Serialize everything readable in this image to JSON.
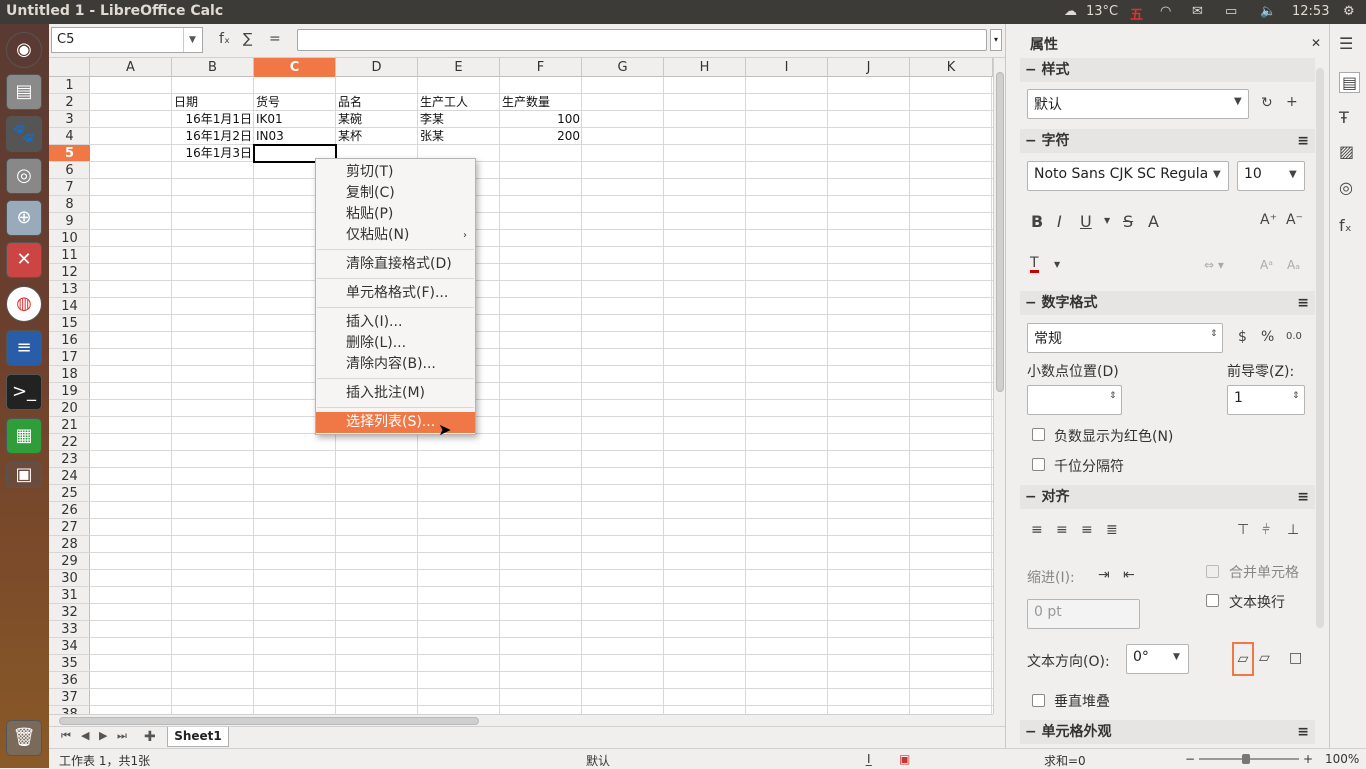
{
  "window": {
    "title": "Untitled 1 - LibreOffice Calc"
  },
  "indicators": {
    "temperature": "13°C",
    "time": "12:53"
  },
  "toolbar": {
    "name_box": "C5",
    "fx": "fₓ",
    "sum": "∑",
    "equals": "="
  },
  "columns": [
    "A",
    "B",
    "C",
    "D",
    "E",
    "F",
    "G",
    "H",
    "I",
    "J",
    "K"
  ],
  "rows": [
    "1",
    "2",
    "3",
    "4",
    "5",
    "6",
    "7",
    "8",
    "9",
    "10",
    "11",
    "12",
    "13",
    "14",
    "15",
    "16",
    "17",
    "18",
    "19",
    "20",
    "21",
    "22",
    "23",
    "24",
    "25",
    "26",
    "27",
    "28",
    "29",
    "30",
    "31",
    "32",
    "33",
    "34",
    "35",
    "36",
    "37",
    "38"
  ],
  "cells": {
    "B2": "日期",
    "C2": "货号",
    "D2": "品名",
    "E2": "生产工人",
    "F2": "生产数量",
    "B3": "16年1月1日",
    "C3": "IK01",
    "D3": "某碗",
    "E3": "李某",
    "F3": "100",
    "B4": "16年1月2日",
    "C4": "IN03",
    "D4": "某杯",
    "E4": "张某",
    "F4": "200",
    "B5": "16年1月3日"
  },
  "context_menu": {
    "cut": "剪切(T)",
    "copy": "复制(C)",
    "paste": "粘贴(P)",
    "paste_special": "仅粘贴(N)",
    "clear_direct": "清除直接格式(D)",
    "format_cells": "单元格格式(F)...",
    "insert": "插入(I)...",
    "delete": "删除(L)...",
    "clear_contents": "清除内容(B)...",
    "insert_comment": "插入批注(M)",
    "selection_list": "选择列表(S)..."
  },
  "sheet": {
    "tab": "Sheet1"
  },
  "status": {
    "sheet_info": "工作表 1，共1张",
    "style": "默认",
    "sum": "求和=0",
    "zoom": "100%"
  },
  "sidebar": {
    "title": "属性",
    "styles_header": "样式",
    "style_value": "默认",
    "char_header": "字符",
    "font_name": "Noto Sans CJK SC Regula",
    "font_size": "10",
    "numfmt_header": "数字格式",
    "numfmt_value": "常规",
    "decimals_label": "小数点位置(D)",
    "leading_zeros_label": "前导零(Z):",
    "leading_zeros_value": "1",
    "negative_red": "负数显示为红色(N)",
    "thousands_sep": "千位分隔符",
    "align_header": "对齐",
    "indent_label": "缩进(I):",
    "indent_value": "0 pt",
    "merge_cells": "合并单元格",
    "wrap_text": "文本换行",
    "text_dir_label": "文本方向(O):",
    "text_dir_value": "0°",
    "vertical_stack": "垂直堆叠",
    "cell_appearance_header": "单元格外观"
  }
}
